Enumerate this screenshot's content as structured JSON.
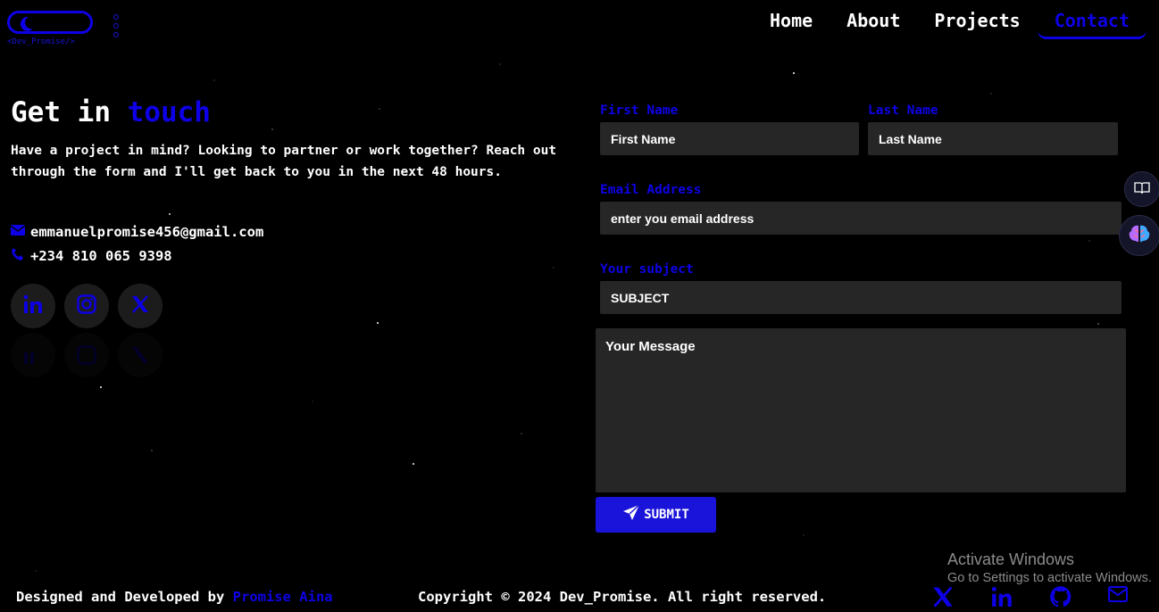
{
  "brand": {
    "logo_text": "<Dev_Promise/>"
  },
  "nav": {
    "items": [
      {
        "label": "Home"
      },
      {
        "label": "About"
      },
      {
        "label": "Projects"
      },
      {
        "label": "Contact"
      }
    ],
    "active": "Contact"
  },
  "hero": {
    "heading_prefix": "Get in ",
    "heading_accent": "touch",
    "intro": "Have a project in mind? Looking to partner or work together? Reach out through the form and I'll get back to you in the next 48 hours.",
    "email": "emmanuelpromise456@gmail.com",
    "phone": "+234 810 065 9398"
  },
  "socials": [
    "linkedin-icon",
    "instagram-icon",
    "x-icon"
  ],
  "form": {
    "first_name": {
      "label": "First Name",
      "placeholder": "First Name"
    },
    "last_name": {
      "label": "Last Name",
      "placeholder": "Last Name"
    },
    "email": {
      "label": "Email Address",
      "placeholder": "enter you email address"
    },
    "subject": {
      "label": "Your subject",
      "placeholder": "SUBJECT"
    },
    "message": {
      "placeholder": "Your Message"
    },
    "submit_label": "SUBMIT"
  },
  "watermark": {
    "title": "Activate Windows",
    "subtitle": "Go to Settings to activate Windows."
  },
  "footer": {
    "designed_prefix": "Designed and Developed by ",
    "designer": "Promise Aina",
    "copyright": "Copyright © 2024 Dev_Promise. All right reserved.",
    "icons": [
      "x-icon",
      "linkedin-icon",
      "github-icon",
      "mail-icon"
    ]
  },
  "colors": {
    "accent": "#0e00e6",
    "field_bg": "#262626",
    "background": "#000000"
  }
}
